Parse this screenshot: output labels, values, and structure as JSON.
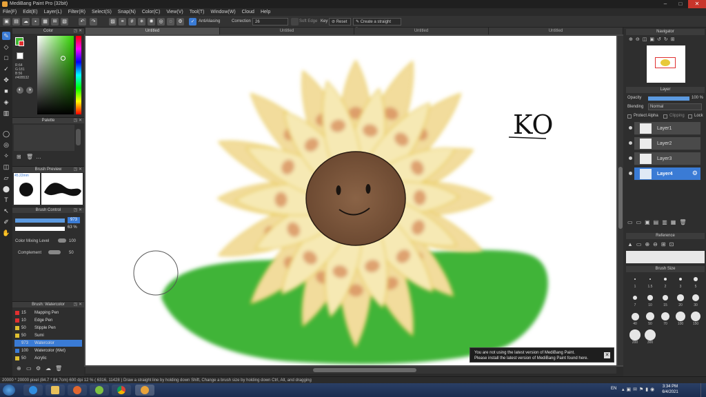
{
  "window": {
    "title": "MediBang Paint Pro (32bit)"
  },
  "menu": [
    "File(F)",
    "Edit(E)",
    "Layer(L)",
    "Filter(R)",
    "Select(S)",
    "Snap(N)",
    "Color(C)",
    "View(V)",
    "Tool(T)",
    "Window(W)",
    "Cloud",
    "Help"
  ],
  "toolbar": {
    "antialiasing": "AntiAliasing",
    "correction_label": "Correction",
    "correction_value": "26",
    "soft_edge": "Soft Edge",
    "key": "Key",
    "reset": "Reset",
    "straight_line": "Create a straight line"
  },
  "tabs": [
    "Untitled",
    "Untitled",
    "Untitled",
    "Untitled"
  ],
  "left": {
    "color_title": "Color",
    "color_readout": [
      "R:64",
      "G:181",
      "B:56",
      "#40B532"
    ],
    "palette_title": "Palette",
    "brush_preview_title": "Brush Preview",
    "brush_preview_size": "45.22mm",
    "brush_control_title": "Brush Control",
    "size_value": "973",
    "opacity_value": "63",
    "opacity_unit": "%",
    "color_mixing_label": "Color Mixing Level",
    "color_mixing_value": "100",
    "complement_label": "Complement",
    "complement_value": "50",
    "brush_list_title": "Brush: Watercolor",
    "brushes": [
      {
        "size": "15",
        "name": "Mapping Pen",
        "color": "#e03030"
      },
      {
        "size": "10",
        "name": "Edge Pen",
        "color": "#e03030"
      },
      {
        "size": "50",
        "name": "Stipple Pen",
        "color": "#e0c030"
      },
      {
        "size": "50",
        "name": "Sumi",
        "color": "#e0c030"
      },
      {
        "size": "973",
        "name": "Watercolor",
        "color": "#3a7bd5"
      },
      {
        "size": "100",
        "name": "Watercolor (Wet)",
        "color": "#3a7bd5"
      },
      {
        "size": "50",
        "name": "Acrylic",
        "color": "#e0c030"
      }
    ]
  },
  "canvas": {
    "handwriting": "KO"
  },
  "notice": {
    "line1": "You are not using the latest version of MediBang Paint.",
    "line2": "Please install the latest version of MediBang Paint found here."
  },
  "right": {
    "navigator_title": "Navigator",
    "layer_title": "Layer",
    "opacity_label": "Opacity",
    "opacity_value": "100 %",
    "blending_label": "Blending",
    "blending_value": "Normal",
    "protect_alpha": "Protect Alpha",
    "clipping": "Clipping",
    "lock": "Lock",
    "layers": [
      "Layer1",
      "Layer2",
      "Layer3",
      "Layer4"
    ],
    "reference_title": "Reference",
    "brush_size_title": "Brush Size",
    "brush_sizes": [
      "1",
      "1.5",
      "2",
      "3",
      "5",
      "7",
      "10",
      "15",
      "20",
      "30",
      "40",
      "50",
      "70",
      "100",
      "150",
      "200",
      "300"
    ]
  },
  "status": {
    "text": "20000 * 20000 pixel   (84.7 * 84.7cm)   600 dpi   12 %   ( 6316, 11428 )   Draw a straight line by holding down Shift, Change a brush size by holding down Ctrl, Alt, and dragging"
  },
  "taskbar": {
    "lang": "EN",
    "time": "3:34 PM",
    "date": "6/4/2021"
  },
  "colors": {
    "accent": "#3a7bd5",
    "grass": "#3fb437",
    "petal_fill": "#f5e6a8",
    "petal_outline": "#e8c93a",
    "center": "#7a553a"
  }
}
